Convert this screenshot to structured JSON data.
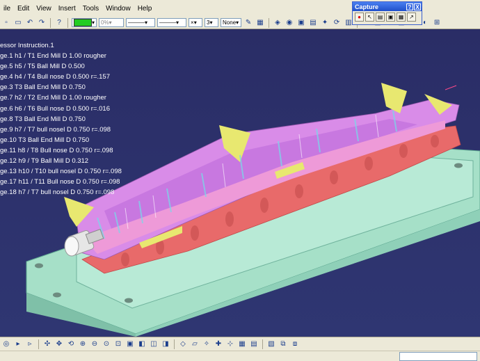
{
  "menu": {
    "items": [
      "ile",
      "Edit",
      "View",
      "Insert",
      "Tools",
      "Window",
      "Help"
    ]
  },
  "toolbar": {
    "percent_value": "0%",
    "count_value": "3",
    "pattern_value": "None",
    "color_swatch": "#22cc22"
  },
  "capture": {
    "title": "Capture",
    "help": "?",
    "close": "X"
  },
  "tree": {
    "lines": [
      "essor Instruction.1",
      "ge.1  h1 / T1 End Mill D 1.00 rougher",
      "ge.5  h5 / T5 Ball Mill D 0.500",
      "ge.4  h4 / T4 Bull nose D 0.500 r=.157",
      "ge.3  T3 Ball End Mill D 0.750",
      "ge.7  h2 / T2 End Mill D 1.00 rougher",
      "ge.6  h6 / T6 Bull nose  D 0.500 r=.016",
      "ge.8  T3 Ball End Mill D 0.750",
      "ge.9  h7 / T7 bull nosel D 0.750 r=.098",
      "ge.10  T3 Ball End Mill D 0.750",
      "ge.11  h8 / T8 Bull nose D 0.750 r=.098",
      "ge.12  h9 / T9 Ball Mill D 0.312",
      "ge.13  h10 / T10 bull nosel D 0.750 r=.098",
      "ge.17  h11 / T11 Bull nose D 0.750 r=.098",
      "ge.18  h7 / T7 bull nosel D 0.750 r=.098"
    ]
  },
  "colors": {
    "background": "#2a2d66",
    "base": "#a6e0c8",
    "stock": "#e86a6a",
    "part": "#d98ce8",
    "highlight": "#e8e870",
    "toolbar": "#ece9d8"
  }
}
